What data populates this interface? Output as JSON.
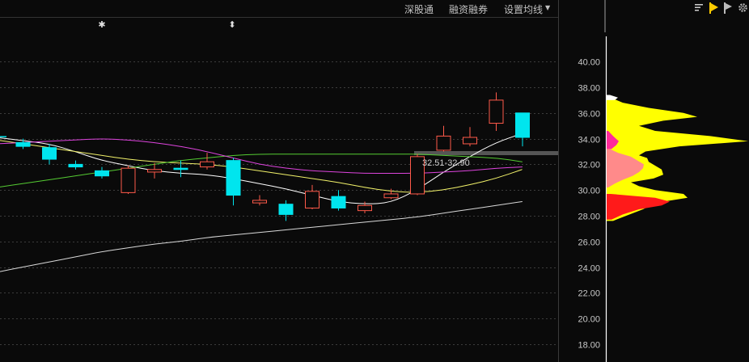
{
  "toolbar": {
    "shenguto": "深股通",
    "rongzi": "融资融券",
    "ma_settings": "设置均线",
    "dropdown_icon": "caret-down-icon"
  },
  "right_icons": [
    "bars-icon",
    "play-icon",
    "flag-icon",
    "gear-icon"
  ],
  "colors": {
    "background": "#0a0a0a",
    "up": "#ff5a4a",
    "down": "#00e5ee",
    "ma5": "#ffffff",
    "ma10": "#f2f26a",
    "ma20": "#55cc33",
    "ma60": "#dd44dd",
    "ma250": "#d8d8d8",
    "grid": "#3c3c3c",
    "profile_yellow": "#ffff00",
    "profile_red": "#ff1a1a",
    "profile_pink": "#ff8a8a",
    "profile_magenta": "#ff2a9a"
  },
  "chart_data": {
    "type": "candlestick",
    "y_axis": {
      "min": 17,
      "max": 42,
      "ticks": [
        "40.00",
        "38.00",
        "36.00",
        "34.00",
        "32.00",
        "30.00",
        "28.00",
        "26.00",
        "24.00",
        "22.00",
        "20.00",
        "18.00"
      ]
    },
    "grid": true,
    "markers": [
      "✱",
      "⬍"
    ],
    "annotation": "32.51-32.90",
    "candles": [
      {
        "o": 33.7,
        "c": 33.4,
        "h": 34.0,
        "l": 33.2
      },
      {
        "o": 33.3,
        "c": 32.4,
        "h": 33.6,
        "l": 32.0
      },
      {
        "o": 32.0,
        "c": 31.8,
        "h": 32.3,
        "l": 31.6
      },
      {
        "o": 31.5,
        "c": 31.1,
        "h": 31.8,
        "l": 30.9
      },
      {
        "o": 29.8,
        "c": 31.7,
        "h": 31.9,
        "l": 29.7
      },
      {
        "o": 31.4,
        "c": 31.6,
        "h": 32.1,
        "l": 30.9
      },
      {
        "o": 31.7,
        "c": 31.6,
        "h": 32.3,
        "l": 31.0
      },
      {
        "o": 31.8,
        "c": 32.2,
        "h": 32.9,
        "l": 31.6
      },
      {
        "o": 32.3,
        "c": 29.6,
        "h": 32.5,
        "l": 28.8
      },
      {
        "o": 29.0,
        "c": 29.2,
        "h": 29.6,
        "l": 28.8
      },
      {
        "o": 28.9,
        "c": 28.1,
        "h": 29.2,
        "l": 27.6
      },
      {
        "o": 28.6,
        "c": 29.9,
        "h": 30.4,
        "l": 28.5
      },
      {
        "o": 29.5,
        "c": 28.6,
        "h": 30.0,
        "l": 28.4
      },
      {
        "o": 28.4,
        "c": 28.8,
        "h": 29.1,
        "l": 28.2
      },
      {
        "o": 29.4,
        "c": 29.7,
        "h": 30.1,
        "l": 29.3
      },
      {
        "o": 29.7,
        "c": 32.6,
        "h": 32.8,
        "l": 29.6
      },
      {
        "o": 33.1,
        "c": 34.2,
        "h": 35.0,
        "l": 33.0
      },
      {
        "o": 33.6,
        "c": 34.1,
        "h": 34.9,
        "l": 33.4
      },
      {
        "o": 35.2,
        "c": 37.0,
        "h": 37.6,
        "l": 34.6
      },
      {
        "o": 36.0,
        "c": 34.1,
        "h": 36.0,
        "l": 33.4
      }
    ],
    "ma_lines": [
      {
        "name": "MA5",
        "values": [
          33.85,
          33.6,
          33.0,
          32.3,
          31.9,
          31.5,
          31.3,
          31.2,
          30.9,
          30.5,
          30.1,
          29.6,
          29.1,
          28.9,
          29.0,
          30.0,
          31.4,
          32.6,
          33.7,
          34.4
        ]
      },
      {
        "name": "MA10",
        "values": [
          33.6,
          33.3,
          33.0,
          32.7,
          32.4,
          32.2,
          32.1,
          32.0,
          31.8,
          31.5,
          31.2,
          30.9,
          30.6,
          30.2,
          29.9,
          29.8,
          30.0,
          30.4,
          30.9,
          31.6
        ]
      },
      {
        "name": "MA20",
        "values": [
          30.5,
          30.8,
          31.1,
          31.4,
          31.7,
          32.0,
          32.3,
          32.5,
          32.7,
          32.8,
          32.8,
          32.8,
          32.8,
          32.8,
          32.8,
          32.8,
          32.7,
          32.6,
          32.5,
          32.2
        ]
      },
      {
        "name": "MA60",
        "values": [
          33.7,
          33.8,
          33.9,
          34.0,
          33.9,
          33.7,
          33.4,
          33.0,
          32.5,
          32.0,
          31.7,
          31.5,
          31.4,
          31.3,
          31.3,
          31.3,
          31.4,
          31.5,
          31.7,
          31.8
        ]
      },
      {
        "name": "MA250",
        "values": [
          24.0,
          24.4,
          24.8,
          25.2,
          25.5,
          25.8,
          26.0,
          26.3,
          26.5,
          26.7,
          26.9,
          27.1,
          27.3,
          27.5,
          27.7,
          27.9,
          28.2,
          28.5,
          28.8,
          29.1
        ]
      }
    ],
    "volume_profile": {
      "yellow": [
        [
          37.2,
          5
        ],
        [
          36.8,
          20
        ],
        [
          36.4,
          52
        ],
        [
          36.0,
          95
        ],
        [
          35.7,
          112
        ],
        [
          35.4,
          70
        ],
        [
          35.0,
          40
        ],
        [
          34.6,
          60
        ],
        [
          34.2,
          128
        ],
        [
          33.8,
          175
        ],
        [
          33.4,
          90
        ],
        [
          33.0,
          48
        ],
        [
          32.7,
          40
        ],
        [
          32.5,
          50
        ],
        [
          32.2,
          52
        ],
        [
          31.9,
          60
        ],
        [
          31.6,
          68
        ],
        [
          31.2,
          70
        ],
        [
          30.9,
          58
        ],
        [
          30.6,
          30
        ],
        [
          30.3,
          40
        ],
        [
          30.0,
          60
        ],
        [
          29.7,
          95
        ],
        [
          29.4,
          100
        ],
        [
          29.0,
          60
        ],
        [
          28.5,
          45
        ],
        [
          27.9,
          20
        ],
        [
          27.6,
          8
        ]
      ],
      "red": [
        [
          29.7,
          5
        ],
        [
          29.4,
          60
        ],
        [
          29.1,
          78
        ],
        [
          28.8,
          68
        ],
        [
          28.5,
          40
        ],
        [
          28.1,
          20
        ],
        [
          27.7,
          6
        ]
      ],
      "pink": [
        [
          33.2,
          4
        ],
        [
          32.9,
          14
        ],
        [
          32.6,
          30
        ],
        [
          32.3,
          38
        ],
        [
          32.0,
          46
        ],
        [
          31.7,
          45
        ],
        [
          31.4,
          40
        ],
        [
          31.1,
          32
        ],
        [
          30.8,
          20
        ],
        [
          30.5,
          10
        ],
        [
          30.2,
          2
        ]
      ],
      "magenta": [
        [
          34.6,
          2
        ],
        [
          34.2,
          8
        ],
        [
          33.8,
          15
        ],
        [
          33.5,
          12
        ],
        [
          33.2,
          6
        ]
      ],
      "white": [
        [
          37.4,
          4
        ],
        [
          37.2,
          14
        ],
        [
          37.0,
          10
        ]
      ]
    }
  }
}
